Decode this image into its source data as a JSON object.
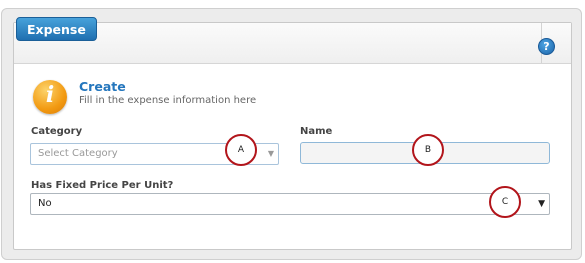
{
  "header": {
    "title": "Expense",
    "help": "?"
  },
  "intro": {
    "title": "Create",
    "subtitle": "Fill in the expense information here"
  },
  "form": {
    "category": {
      "label": "Category",
      "placeholder": "Select Category"
    },
    "name": {
      "label": "Name",
      "value": ""
    },
    "fixed_price": {
      "label": "Has Fixed Price Per Unit?",
      "value": "No"
    }
  },
  "markers": {
    "a": "A",
    "b": "B",
    "c": "C"
  },
  "colors": {
    "accent": "#2476bd",
    "marker": "#b2151b",
    "info_icon": "#f29a12"
  }
}
